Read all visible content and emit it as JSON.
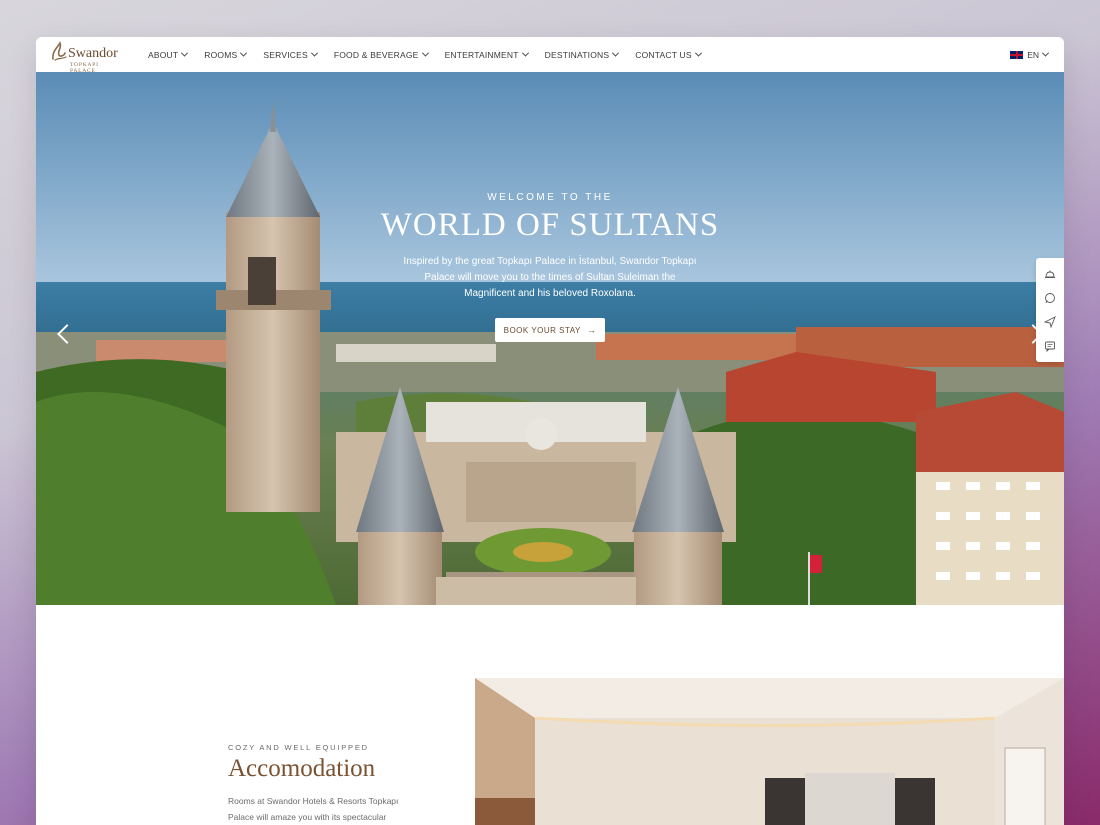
{
  "brand": {
    "name": "Swandor",
    "subtitle": "TOPKAPI PALACE",
    "accent_color": "#7a5232"
  },
  "nav": {
    "items": [
      {
        "label": "ABOUT"
      },
      {
        "label": "ROOMS"
      },
      {
        "label": "SERVICES"
      },
      {
        "label": "FOOD & BEVERAGE"
      },
      {
        "label": "ENTERTAINMENT"
      },
      {
        "label": "DESTINATIONS"
      },
      {
        "label": "CONTACT US"
      }
    ],
    "language": {
      "label": "EN",
      "flag_icon": "uk-flag-icon"
    }
  },
  "hero": {
    "eyebrow": "WELCOME TO THE",
    "title": "WORLD OF SULTANS",
    "description": "Inspired by the great Topkapı Palace in İstanbul, Swandor Topkapı Palace will move you to the times of Sultan Suleiman the Magnificent and his beloved Roxolana.",
    "cta_label": "BOOK YOUR STAY",
    "cta_icon": "arrow-right-icon",
    "prev_icon": "chevron-left-icon",
    "next_icon": "chevron-right-icon"
  },
  "side_rail": {
    "icons": [
      "reception-bell-icon",
      "whatsapp-icon",
      "send-icon",
      "chat-icon"
    ]
  },
  "accommodation": {
    "eyebrow": "COZY AND WELL EQUIPPED",
    "title": "Accomodation",
    "description": "Rooms at Swandor Hotels & Resorts Topkapı Palace will amaze you with its spectacular"
  }
}
